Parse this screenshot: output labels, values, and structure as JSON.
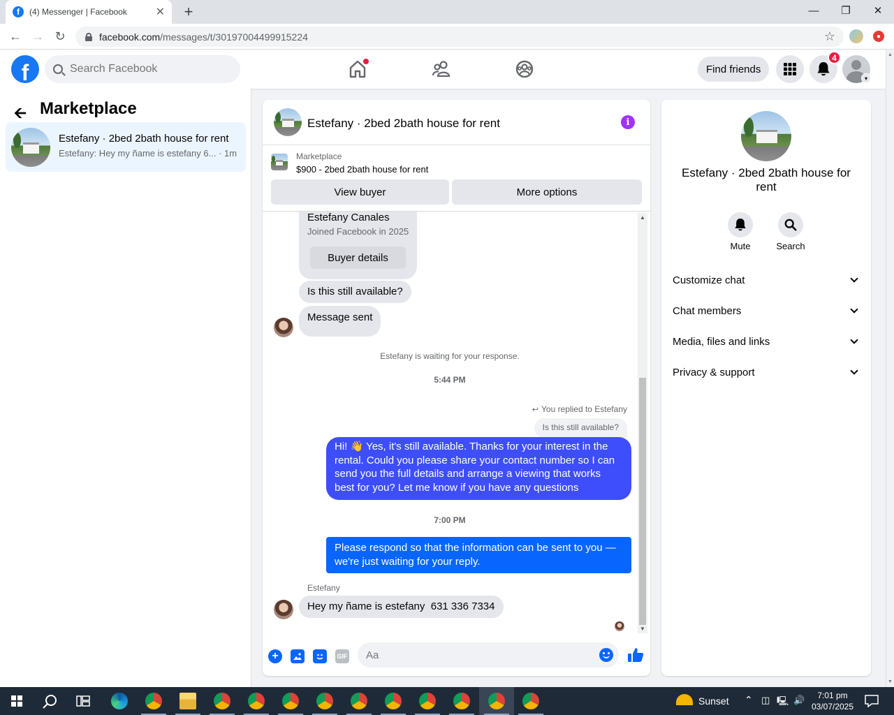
{
  "browser": {
    "tab_title": "(4) Messenger | Facebook",
    "url_domain": "facebook.com",
    "url_path": "/messages/t/30197004499915224"
  },
  "topnav": {
    "search_placeholder": "Search Facebook",
    "find_friends_label": "Find friends",
    "notification_count": "4"
  },
  "sidebar": {
    "title": "Marketplace",
    "conversations": [
      {
        "name": "Estefany · 2bed 2bath house for rent",
        "preview": "Estefany: Hey my ñame is estefany 6...",
        "time": "· 1m"
      }
    ]
  },
  "chat": {
    "title": "Estefany · 2bed 2bath house for rent",
    "marketplace_label": "Marketplace",
    "listing": "$900 - 2bed 2bath house for rent",
    "view_buyer_label": "View buyer",
    "more_options_label": "More options",
    "buyer_card": {
      "name": "Estefany Canales",
      "joined": "Joined Facebook in 2025",
      "button": "Buyer details"
    },
    "msg_available": "Is this still available?",
    "msg_sent": "Message sent",
    "waiting_note": "Estefany is waiting for your response.",
    "time1": "5:44 PM",
    "reply_note": "You replied to Estefany",
    "quoted": "Is this still available?",
    "reply_message": "Hi! 👋 Yes, it's still available. Thanks for your interest in the rental. Could you please share your contact number so I can send you the full details and arrange a viewing that works best for you? Let me know if you have any questions",
    "time2": "7:00 PM",
    "followup": "Please respond so that the information can be sent to you — we're just waiting for your reply.",
    "sender_label": "Estefany",
    "last_message": "Hey my ñame is estefany  631 336 7334",
    "composer_placeholder": "Aa",
    "gif_label": "GIF"
  },
  "details": {
    "title": "Estefany · 2bed 2bath house for rent",
    "mute_label": "Mute",
    "search_label": "Search",
    "sections": [
      "Customize chat",
      "Chat members",
      "Media, files and links",
      "Privacy & support"
    ]
  },
  "taskbar": {
    "weather": "Sunset",
    "time": "7:01 pm",
    "date": "03/07/2025"
  },
  "colors": {
    "fb_blue": "#1877f2",
    "bubble_blue": "#3e4efd",
    "bubble_blue_alt": "#0866ff",
    "info_purple": "#a033ff",
    "badge_red": "#e41e3f"
  }
}
